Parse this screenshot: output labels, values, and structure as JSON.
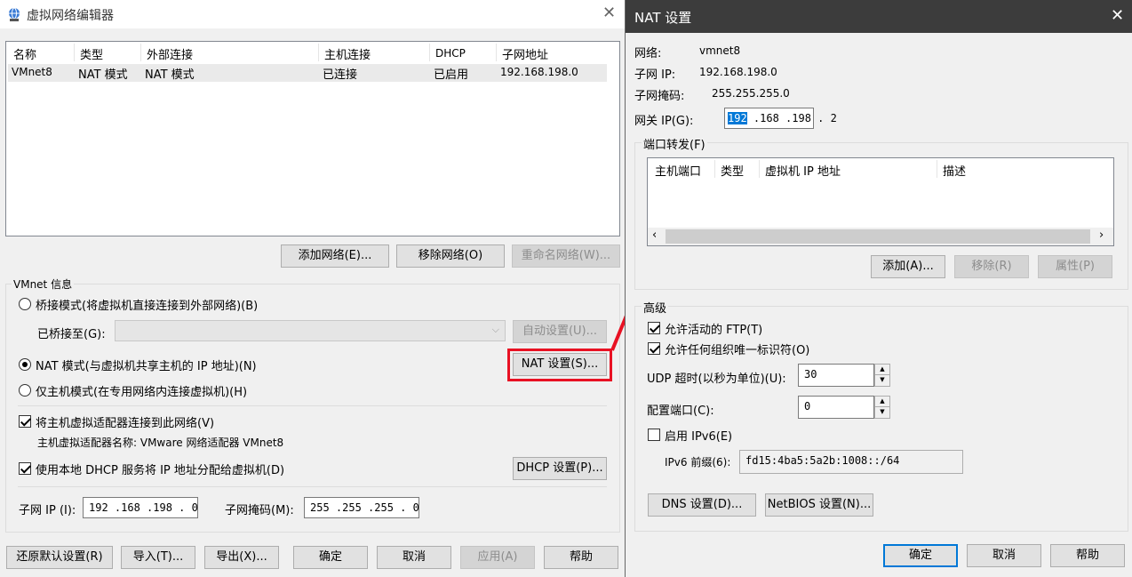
{
  "left": {
    "title": "虚拟网络编辑器",
    "columns": [
      "名称",
      "类型",
      "外部连接",
      "主机连接",
      "DHCP",
      "子网地址"
    ],
    "row": [
      "VMnet8",
      "NAT 模式",
      "NAT 模式",
      "已连接",
      "已启用",
      "192.168.198.0"
    ],
    "add_network": "添加网络(E)...",
    "remove_network": "移除网络(O)",
    "rename_network": "重命名网络(W)...",
    "vmnet_info": "VMnet 信息",
    "bridge_mode": "桥接模式(将虚拟机直接连接到外部网络)(B)",
    "bridged_to": "已桥接至(G):",
    "auto_settings": "自动设置(U)...",
    "nat_mode": "NAT 模式(与虚拟机共享主机的 IP 地址)(N)",
    "nat_settings": "NAT 设置(S)...",
    "host_only": "仅主机模式(在专用网络内连接虚拟机)(H)",
    "connect_adapter": "将主机虚拟适配器连接到此网络(V)",
    "adapter_name": "主机虚拟适配器名称: VMware 网络适配器 VMnet8",
    "use_dhcp": "使用本地 DHCP 服务将 IP 地址分配给虚拟机(D)",
    "dhcp_settings": "DHCP 设置(P)...",
    "subnet_ip_label": "子网 IP (I):",
    "subnet_ip_value": "192 .168 .198 . 0",
    "subnet_mask_label": "子网掩码(M):",
    "subnet_mask_value": "255 .255 .255 . 0",
    "restore_defaults": "还原默认设置(R)",
    "import": "导入(T)...",
    "export": "导出(X)...",
    "ok": "确定",
    "cancel": "取消",
    "apply": "应用(A)",
    "help": "帮助"
  },
  "right": {
    "title": "NAT 设置",
    "network_label": "网络:",
    "network_value": "vmnet8",
    "subnet_ip_label": "子网 IP:",
    "subnet_ip_value": "192.168.198.0",
    "subnet_mask_label": "子网掩码:",
    "subnet_mask_value": "255.255.255.0",
    "gateway_label": "网关 IP(G):",
    "gateway_sel": "192",
    "gateway_rest": " .168 .198 . 2",
    "port_forward": "端口转发(F)",
    "pf_columns": [
      "主机端口",
      "类型",
      "虚拟机 IP 地址",
      "描述"
    ],
    "add": "添加(A)...",
    "remove": "移除(R)",
    "properties": "属性(P)",
    "advanced": "高级",
    "allow_ftp": "允许活动的 FTP(T)",
    "allow_oui": "允许任何组织唯一标识符(O)",
    "udp_timeout_label": "UDP 超时(以秒为单位)(U):",
    "udp_timeout_value": "30",
    "config_port_label": "配置端口(C):",
    "config_port_value": "0",
    "enable_ipv6": "启用 IPv6(E)",
    "ipv6_prefix_label": "IPv6 前缀(6):",
    "ipv6_prefix_value": "fd15:4ba5:5a2b:1008::/64",
    "dns_settings": "DNS 设置(D)...",
    "netbios_settings": "NetBIOS 设置(N)...",
    "ok": "确定",
    "cancel": "取消",
    "help": "帮助"
  },
  "colors": {
    "accent": "#0078d7",
    "highlight": "#e81123",
    "selection": "#0078d7"
  }
}
